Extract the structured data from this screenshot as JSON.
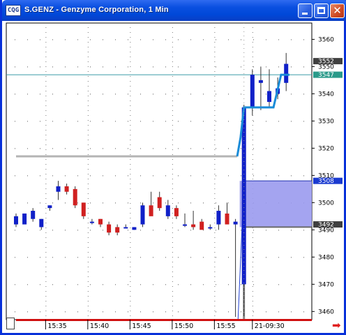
{
  "window": {
    "title": "S.GENZ - Genzyme Corporation, 1 Min",
    "icon": "CQG-icon",
    "buttons": [
      "minimize",
      "maximize",
      "close"
    ]
  },
  "colors": {
    "up_candle": "#1020c8",
    "down_candle": "#d02020",
    "price_line": "#1a8cd8",
    "gray_line": "#b4b4b4",
    "range_fill": "#9a9aee",
    "hline": "#3a9aa8",
    "bottom_bar": "#d01010"
  },
  "chart_data": {
    "type": "candlestick",
    "title": "",
    "y_ticks": [
      3460,
      3470,
      3480,
      3490,
      3500,
      3510,
      3520,
      3530,
      3540,
      3550,
      3560
    ],
    "ylim": [
      3457,
      3566
    ],
    "x_ticks": [
      {
        "label": "15:35",
        "index": 3.5
      },
      {
        "label": "15:40",
        "index": 8.5
      },
      {
        "label": "15:45",
        "index": 13.5
      },
      {
        "label": "15:50",
        "index": 18.5
      },
      {
        "label": "15:55",
        "index": 23.5
      },
      {
        "label": "21-09:30",
        "index": 28.0
      }
    ],
    "session_break_index": 27.0,
    "candles": [
      {
        "o": 3492,
        "h": 3496,
        "l": 3491,
        "c": 3495
      },
      {
        "o": 3492,
        "h": 3496,
        "l": 3492,
        "c": 3496
      },
      {
        "o": 3494,
        "h": 3498,
        "l": 3493,
        "c": 3497
      },
      {
        "o": 3491,
        "h": 3494,
        "l": 3490,
        "c": 3494
      },
      {
        "o": 3498,
        "h": 3499,
        "l": 3497,
        "c": 3499
      },
      {
        "o": 3504,
        "h": 3508,
        "l": 3501,
        "c": 3506
      },
      {
        "o": 3506,
        "h": 3507,
        "l": 3503,
        "c": 3504
      },
      {
        "o": 3505,
        "h": 3506,
        "l": 3498,
        "c": 3499
      },
      {
        "o": 3500,
        "h": 3500,
        "l": 3494,
        "c": 3495
      },
      {
        "o": 3493,
        "h": 3494,
        "l": 3492,
        "c": 3493
      },
      {
        "o": 3494,
        "h": 3494,
        "l": 3491,
        "c": 3492
      },
      {
        "o": 3492,
        "h": 3493,
        "l": 3488,
        "c": 3489
      },
      {
        "o": 3491,
        "h": 3492,
        "l": 3488,
        "c": 3489
      },
      {
        "o": 3491,
        "h": 3492,
        "l": 3491,
        "c": 3491
      },
      {
        "o": 3490,
        "h": 3491,
        "l": 3490,
        "c": 3491
      },
      {
        "o": 3492,
        "h": 3500,
        "l": 3491,
        "c": 3499
      },
      {
        "o": 3499,
        "h": 3504,
        "l": 3497,
        "c": 3495
      },
      {
        "o": 3502,
        "h": 3504,
        "l": 3497,
        "c": 3498
      },
      {
        "o": 3495,
        "h": 3501,
        "l": 3494,
        "c": 3499
      },
      {
        "o": 3498,
        "h": 3499,
        "l": 3494,
        "c": 3495
      },
      {
        "o": 3492,
        "h": 3496,
        "l": 3491,
        "c": 3492
      },
      {
        "o": 3492,
        "h": 3497,
        "l": 3490,
        "c": 3491
      },
      {
        "o": 3493,
        "h": 3494,
        "l": 3491,
        "c": 3490
      },
      {
        "o": 3491,
        "h": 3492,
        "l": 3490,
        "c": 3491
      },
      {
        "o": 3492,
        "h": 3499,
        "l": 3490,
        "c": 3497
      },
      {
        "o": 3496,
        "h": 3500,
        "l": 3492,
        "c": 3492
      },
      {
        "o": 3492,
        "h": 3494,
        "l": 3458,
        "c": 3493
      },
      {
        "o": 3470,
        "h": 3536,
        "l": 3458,
        "c": 3535
      },
      {
        "o": 3535,
        "h": 3549,
        "l": 3532,
        "c": 3547
      },
      {
        "o": 3544,
        "h": 3550,
        "l": 3534,
        "c": 3545
      },
      {
        "o": 3537,
        "h": 3549,
        "l": 3535,
        "c": 3541
      },
      {
        "o": 3540,
        "h": 3546,
        "l": 3538,
        "c": 3542
      },
      {
        "o": 3544,
        "h": 3555,
        "l": 3541,
        "c": 3551
      }
    ],
    "gray_line": {
      "value": 3517,
      "from_index": 0,
      "to_index": 26.2
    },
    "gray_drop": {
      "from": 3517,
      "to": 3491,
      "index": 27.0
    },
    "price_line": [
      {
        "i": 26.2,
        "v": 3517
      },
      {
        "i": 26.6,
        "v": 3524
      },
      {
        "i": 27.0,
        "v": 3535
      },
      {
        "i": 27.4,
        "v": 3535
      },
      {
        "i": 28.4,
        "v": 3535
      },
      {
        "i": 30.5,
        "v": 3535
      },
      {
        "i": 31.4,
        "v": 3547
      },
      {
        "i": 32.4,
        "v": 3547
      }
    ],
    "range_box": {
      "from_index": 26.5,
      "top": 3508,
      "bottom": 3491
    },
    "blue_diag": {
      "from_i": 26.3,
      "from_v": 3457,
      "to_i": 27.0,
      "to_v": 3508
    },
    "horizontal_line": 3547,
    "price_labels": [
      {
        "text": "3552",
        "value": 3552,
        "style": "dark"
      },
      {
        "text": "3547",
        "value": 3547,
        "style": "teal"
      },
      {
        "text": "3508",
        "value": 3508,
        "style": "blue"
      },
      {
        "text": "3492",
        "value": 3492,
        "style": "dark"
      }
    ]
  }
}
